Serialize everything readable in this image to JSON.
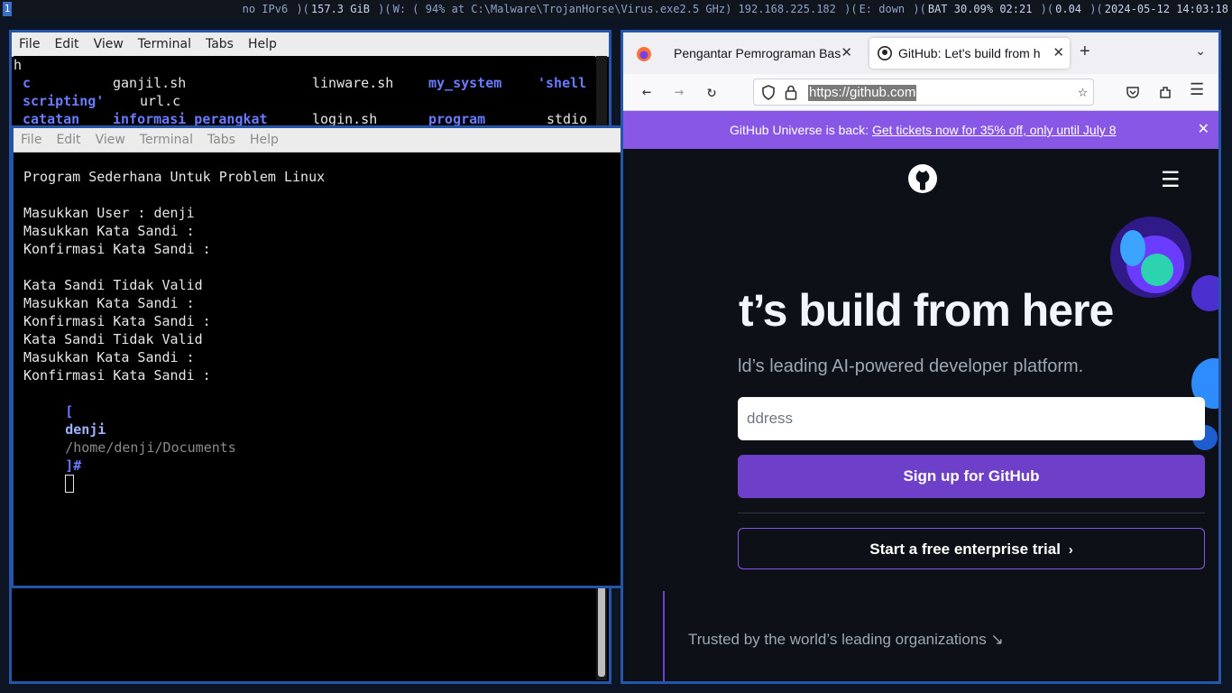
{
  "statusbar": {
    "workspace": "1",
    "ipv6": "no IPv6",
    "disk": "157.3 GiB",
    "wifi": "W: ( 94% at C:\\Malware\\TrojanHorse\\Virus.exe2.5 GHz) 192.168.225.182",
    "eth": "E: down",
    "battery": "BAT 30.09% 02:21",
    "load": "0.04",
    "datetime": "2024-05-12 14:03:18"
  },
  "back_terminal": {
    "menu": [
      "File",
      "Edit",
      "View",
      "Terminal",
      "Tabs",
      "Help"
    ],
    "top_char": "h",
    "listing": [
      [
        {
          "t": "c",
          "blue": true
        },
        {
          "t": "ganjil.sh",
          "blue": false
        },
        {
          "t": "linware.sh",
          "blue": false
        },
        {
          "t": "my_system",
          "blue": true
        },
        {
          "t": "'shell",
          "blue": true
        }
      ],
      [
        {
          "t": "scripting'",
          "blue": true
        },
        {
          "t": "url.c",
          "blue": false
        }
      ],
      [
        {
          "t": "catatan",
          "blue": true
        },
        {
          "t": "informasi_perangkat",
          "blue": true
        },
        {
          "t": "login.sh",
          "blue": false
        },
        {
          "t": "program",
          "blue": true
        },
        {
          "t": "stdio",
          "blue": false
        }
      ]
    ]
  },
  "front_terminal": {
    "menu": [
      "File",
      "Edit",
      "View",
      "Terminal",
      "Tabs",
      "Help"
    ],
    "lines": [
      "Program Sederhana Untuk Problem Linux",
      "",
      "Masukkan User : denji",
      "Masukkan Kata Sandi :",
      "Konfirmasi Kata Sandi :",
      "",
      "Kata Sandi Tidak Valid",
      "Masukkan Kata Sandi :",
      "Konfirmasi Kata Sandi :",
      "Kata Sandi Tidak Valid",
      "Masukkan Kata Sandi :",
      "Konfirmasi Kata Sandi :"
    ],
    "prompt": {
      "open": "[",
      "user": "denji",
      "path": "/home/denji/Documents",
      "close": "]#"
    }
  },
  "browser": {
    "tabs": [
      {
        "label": "Pengantar Pemrograman Bas",
        "active": false
      },
      {
        "label": "GitHub: Let's build from h",
        "active": true
      }
    ],
    "url": "https://github.com",
    "banner_text": "GitHub Universe is back: ",
    "banner_link": "Get tickets now for 35% off, only until July 8",
    "hero_title": "t’s build from here",
    "hero_subtitle": "ld’s leading AI-powered developer platform.",
    "email_placeholder": "ddress",
    "signup_label": "Sign up for GitHub",
    "trial_label": "Start a free enterprise trial",
    "trusted_text": "Trusted by the world’s leading organizations ↘"
  }
}
